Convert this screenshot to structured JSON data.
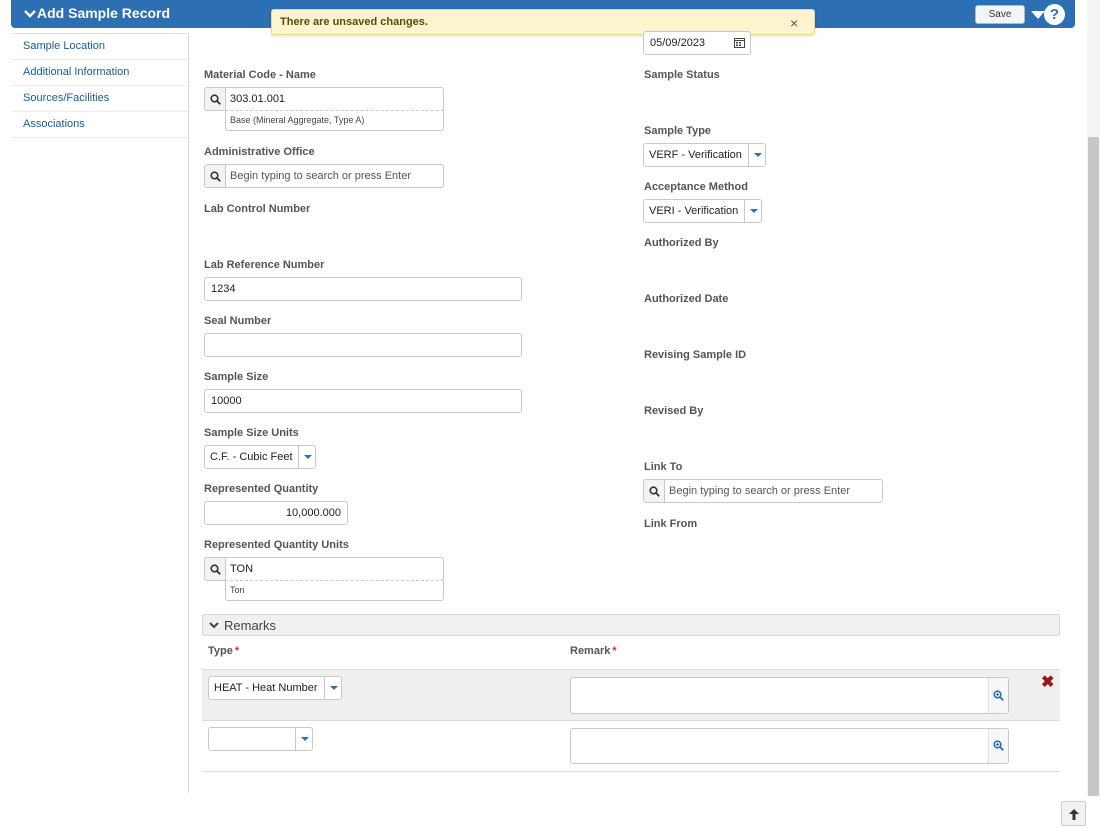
{
  "header": {
    "title": "Add Sample Record",
    "save_label": "Save",
    "help_label": "?"
  },
  "notification": {
    "message": "There are unsaved changes.",
    "close_label": "×"
  },
  "sidebar": {
    "items": [
      {
        "label": "Sample Location"
      },
      {
        "label": "Additional Information"
      },
      {
        "label": "Sources/Facilities"
      },
      {
        "label": "Associations"
      }
    ]
  },
  "form": {
    "sample_date": {
      "value": "05/09/2023"
    },
    "material_code": {
      "label": "Material Code - Name",
      "value": "303.01.001",
      "description": "Base (Mineral Aggregate, Type A)"
    },
    "admin_office": {
      "label": "Administrative Office",
      "placeholder": "Begin typing to search or press Enter"
    },
    "lab_control_number": {
      "label": "Lab Control Number"
    },
    "lab_reference_number": {
      "label": "Lab Reference Number",
      "value": "1234"
    },
    "seal_number": {
      "label": "Seal Number",
      "value": ""
    },
    "sample_size": {
      "label": "Sample Size",
      "value": "10000"
    },
    "sample_size_units": {
      "label": "Sample Size Units",
      "value": "C.F. - Cubic Feet"
    },
    "represented_quantity": {
      "label": "Represented Quantity",
      "value": "10,000.000"
    },
    "represented_quantity_units": {
      "label": "Represented Quantity Units",
      "value": "TON",
      "description": "Ton"
    },
    "sample_status": {
      "label": "Sample Status"
    },
    "sample_type": {
      "label": "Sample Type",
      "value": "VERF - Verification"
    },
    "acceptance_method": {
      "label": "Acceptance Method",
      "value": "VERI - Verification"
    },
    "authorized_by": {
      "label": "Authorized By"
    },
    "authorized_date": {
      "label": "Authorized Date"
    },
    "revising_sample_id": {
      "label": "Revising Sample ID"
    },
    "revised_by": {
      "label": "Revised By"
    },
    "link_to": {
      "label": "Link To",
      "placeholder": "Begin typing to search or press Enter"
    },
    "link_from": {
      "label": "Link From"
    }
  },
  "remarks": {
    "section_title": "Remarks",
    "columns": {
      "type": "Type",
      "remark": "Remark",
      "required_marker": "*"
    },
    "rows": [
      {
        "type": "HEAT - Heat Number",
        "remark": ""
      },
      {
        "type": "",
        "remark": ""
      }
    ]
  },
  "colors": {
    "header_bg": "#2c6fb3",
    "notice_bg": "#fcf3cf",
    "delete": "#a01414"
  },
  "icons": {
    "collapse": "chevron-down-icon",
    "menu": "caret-down-icon",
    "help": "help-icon",
    "search": "search-icon",
    "calendar": "calendar-icon",
    "zoom": "zoom-icon",
    "delete": "delete-icon",
    "scroll_top": "arrow-up-icon"
  }
}
